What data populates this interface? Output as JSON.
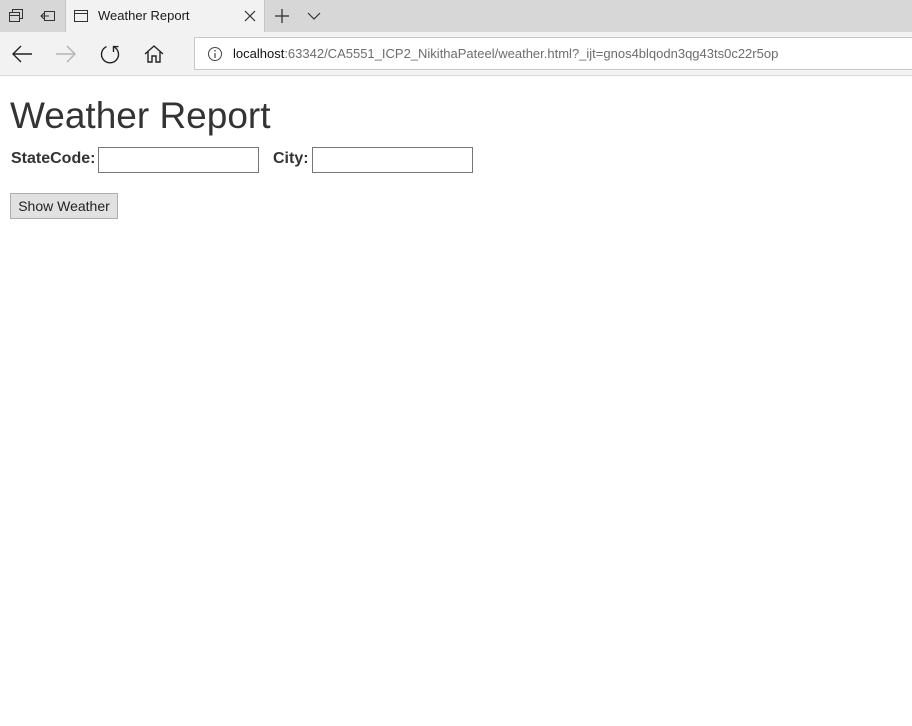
{
  "browser": {
    "tab": {
      "title": "Weather Report"
    },
    "address_bar": {
      "url_host": "localhost",
      "url_rest": ":63342/CA5551_ICP2_NikithaPateel/weather.html?_ijt=gnos4blqodn3qg43ts0c22r5op"
    },
    "icons": {
      "tabs_aside": "tabs-aside-icon",
      "restore_tabs": "restore-tabs-icon",
      "page": "page-icon",
      "close": "close-icon",
      "new_tab": "plus-icon",
      "tab_preview": "chevron-down-icon",
      "back": "back-arrow-icon",
      "forward": "forward-arrow-icon",
      "refresh": "refresh-icon",
      "home": "home-icon",
      "site_info": "info-icon"
    }
  },
  "page": {
    "title": "Weather Report",
    "state_label": "StateCode:",
    "state_value": "",
    "city_label": "City:",
    "city_value": "",
    "button_label": "Show Weather"
  },
  "colors": {
    "tabstrip": "#d7d7d7",
    "toolbar": "#f2f2f2",
    "heading": "#333333",
    "button_bg": "#e1e1e1"
  }
}
